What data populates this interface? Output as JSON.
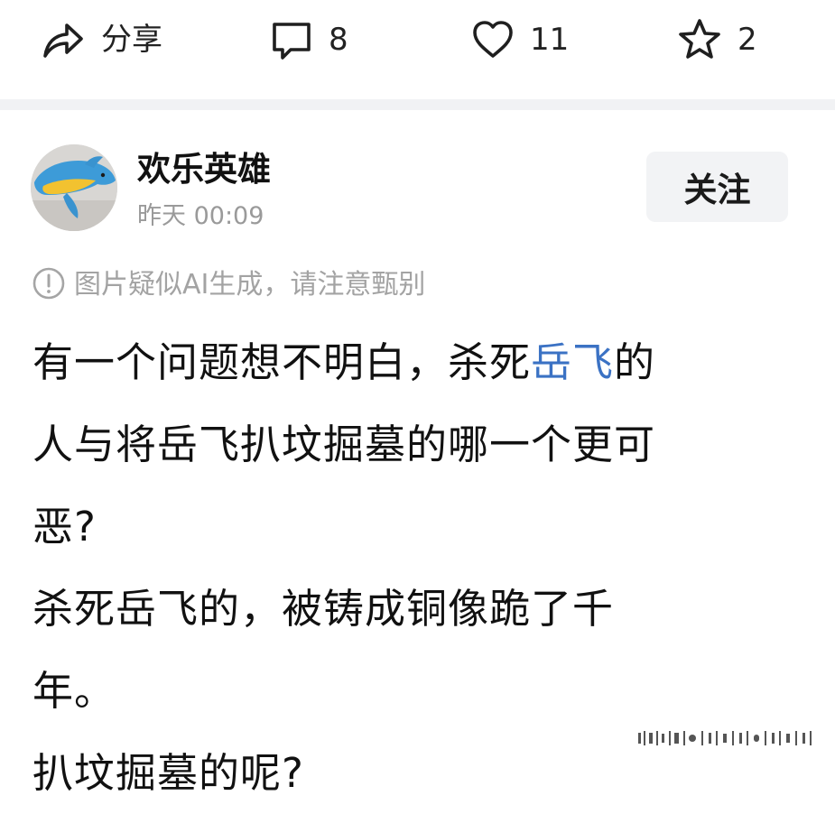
{
  "action_bar": {
    "share": {
      "icon": "share-icon",
      "label": "分享"
    },
    "comment": {
      "icon": "comment-icon",
      "count": "8"
    },
    "like": {
      "icon": "heart-icon",
      "count": "11"
    },
    "favorite": {
      "icon": "star-icon",
      "count": "2"
    }
  },
  "post": {
    "author": {
      "name": "欢乐英雄",
      "time": "昨天  00:09",
      "avatar": "dolphin-plush-avatar"
    },
    "follow_label": "关注",
    "ai_notice": {
      "icon": "info-icon",
      "text": "图片疑似AI生成，请注意甄别"
    },
    "body": {
      "line1_before": "有一个问题想不明白，杀死",
      "line1_link": "岳飞",
      "line1_after": "的",
      "line2": "人与将岳飞扒坟掘墓的哪一个更可",
      "line3": "恶?",
      "line4": "杀死岳飞的，被铸成铜像跪了千",
      "line5": "年。",
      "line6": "扒坟掘墓的呢?"
    }
  },
  "colors": {
    "link": "#3b72c4",
    "divider": "#f1f2f4",
    "follow_bg": "#f2f3f5",
    "muted_text": "#9a9a9a"
  }
}
